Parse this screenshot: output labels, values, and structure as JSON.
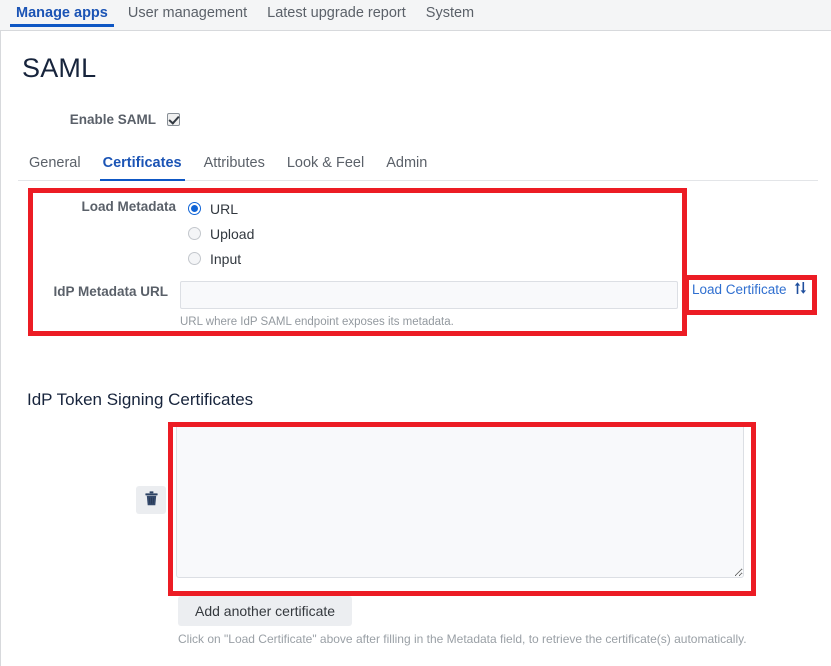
{
  "topnav": {
    "tabs": [
      {
        "label": "Manage apps",
        "active": true
      },
      {
        "label": "User management",
        "active": false
      },
      {
        "label": "Latest upgrade report",
        "active": false
      },
      {
        "label": "System",
        "active": false
      }
    ]
  },
  "page": {
    "title": "SAML"
  },
  "enable": {
    "label": "Enable SAML",
    "checked": true
  },
  "subtabs": {
    "tabs": [
      {
        "label": "General",
        "active": false
      },
      {
        "label": "Certificates",
        "active": true
      },
      {
        "label": "Attributes",
        "active": false
      },
      {
        "label": "Look & Feel",
        "active": false
      },
      {
        "label": "Admin",
        "active": false
      }
    ]
  },
  "metadata": {
    "load_metadata_label": "Load Metadata",
    "options": [
      {
        "label": "URL",
        "selected": true
      },
      {
        "label": "Upload",
        "selected": false
      },
      {
        "label": "Input",
        "selected": false
      }
    ],
    "url_label": "IdP Metadata URL",
    "url_value": "",
    "url_placeholder": "",
    "url_help": "URL where IdP SAML endpoint exposes its metadata."
  },
  "load_certificate": {
    "label": "Load Certificate",
    "icon": "up-down-arrows-icon",
    "glyph": "↑↓"
  },
  "certificates": {
    "heading": "IdP Token Signing Certificates",
    "textarea_value": "",
    "textarea_placeholder": "",
    "delete_icon": "trash-icon",
    "add_button_label": "Add another certificate",
    "footer_help": "Click on \"Load Certificate\" above after filling in the Metadata field, to retrieve the certificate(s) automatically."
  },
  "annotations": {
    "accent_color": "#ec1c24",
    "boxes": [
      {
        "name": "metadata-panel-highlight"
      },
      {
        "name": "load-certificate-highlight"
      },
      {
        "name": "certificate-textarea-highlight"
      }
    ]
  },
  "colors": {
    "accent_blue": "#0e57c4",
    "heading_navy": "#17243c",
    "annotation_red": "#ec1c24"
  }
}
